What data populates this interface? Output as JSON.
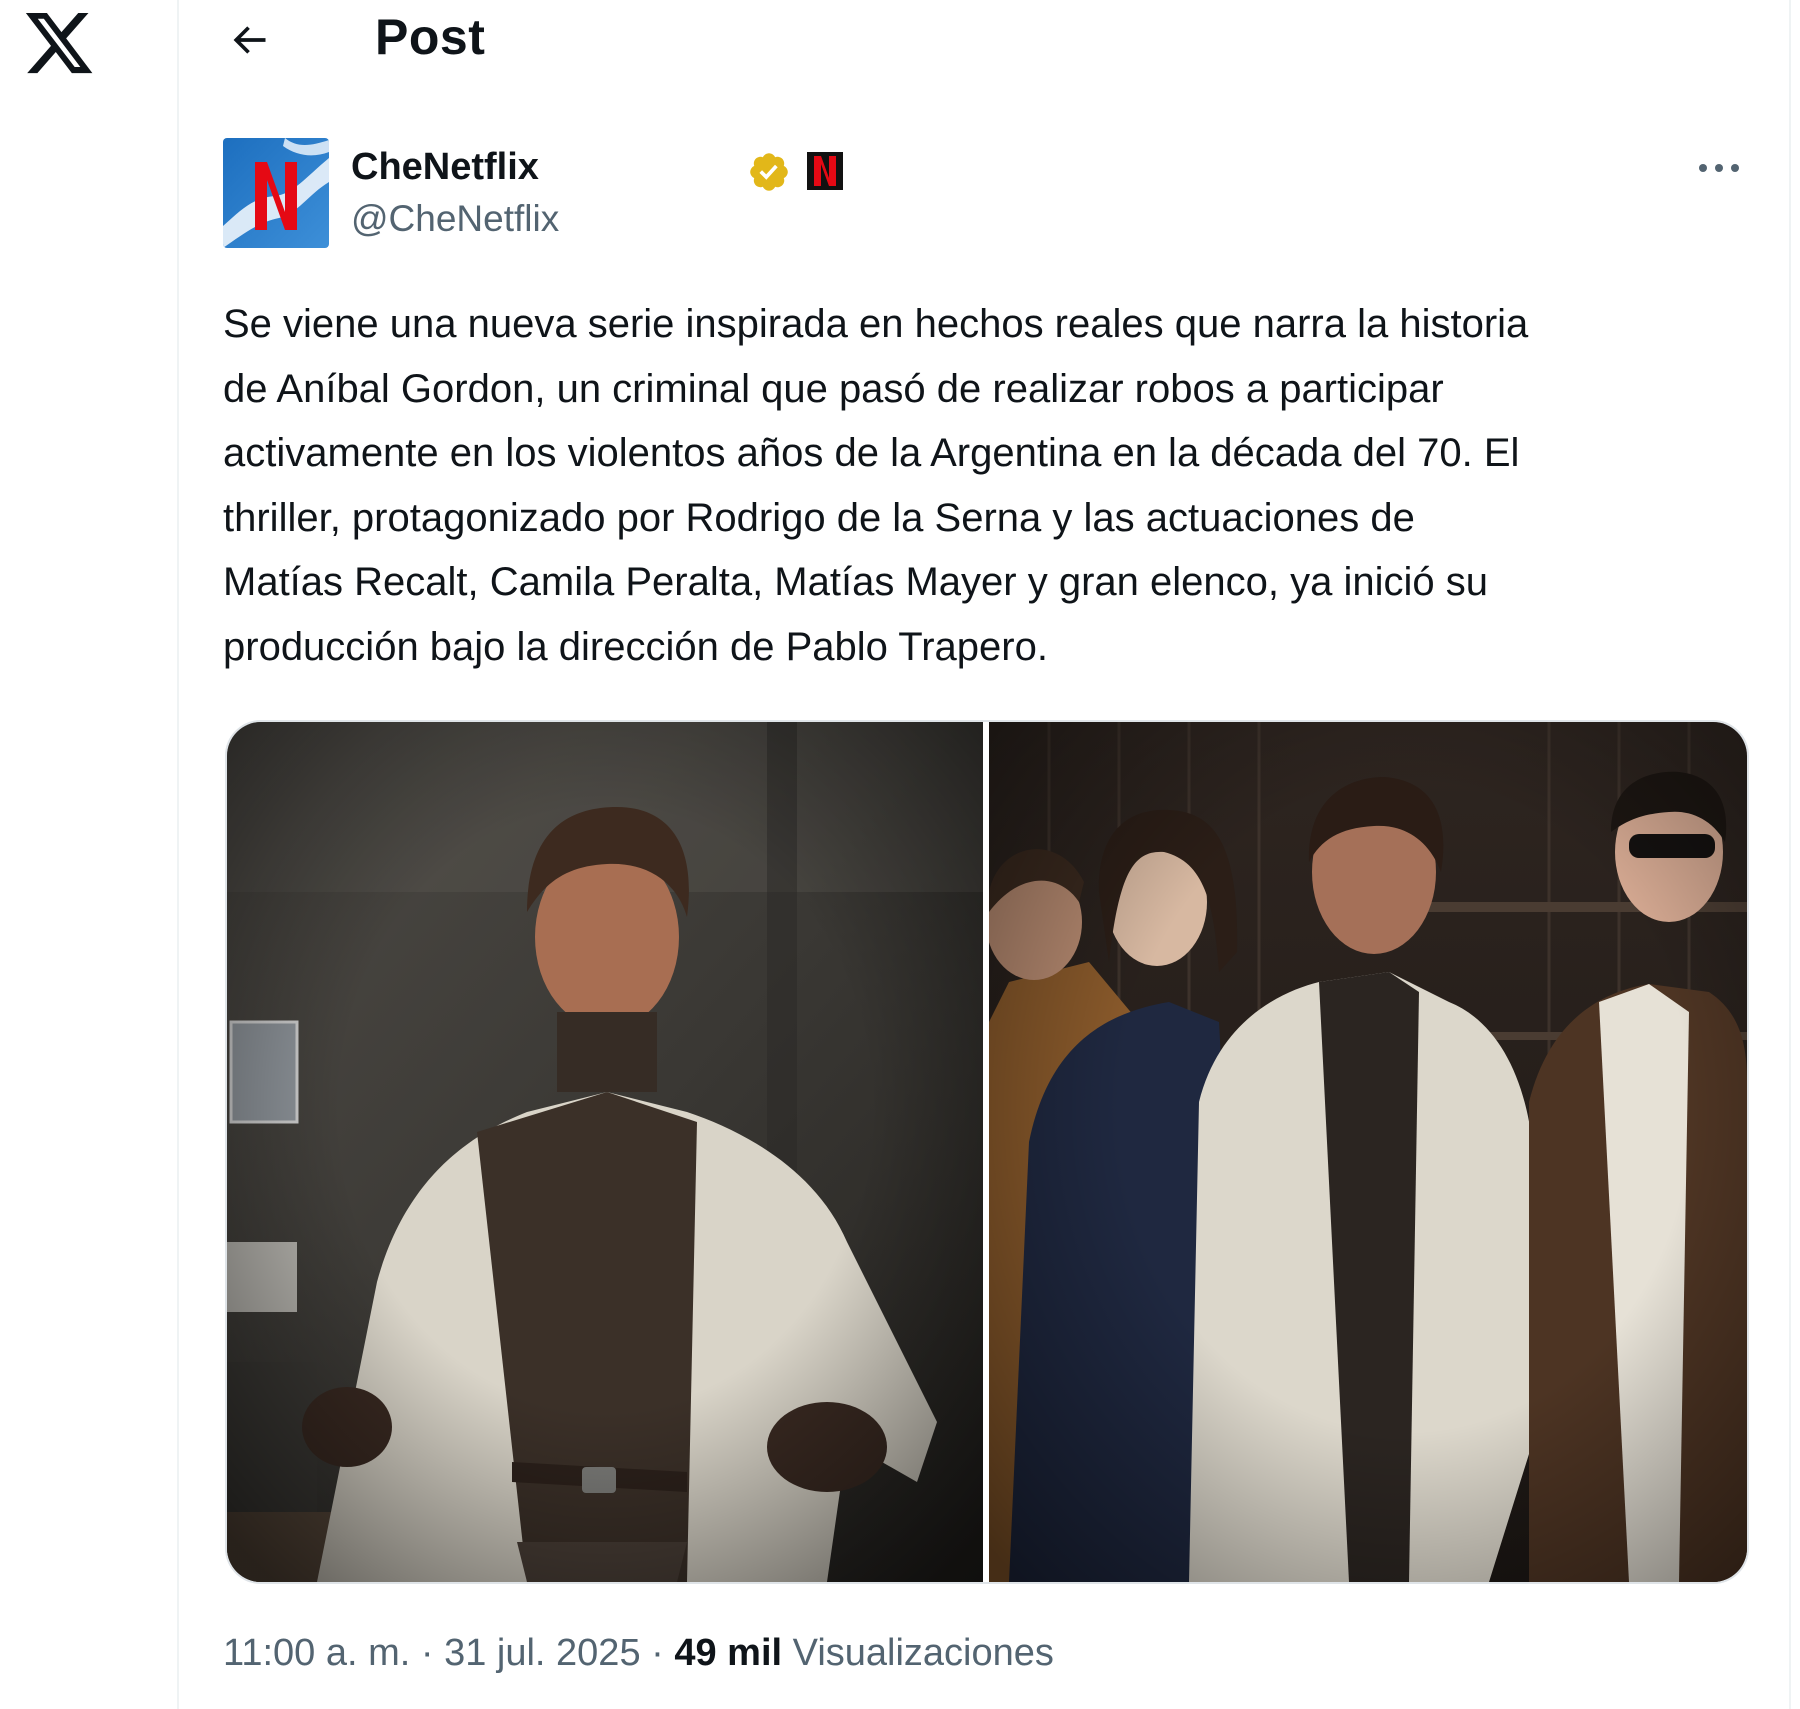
{
  "page": {
    "header_title": "Post"
  },
  "post": {
    "author": {
      "name": "CheNetflix",
      "handle": "@CheNetflix",
      "verified": true,
      "emoji_icon": "netflix-n-icon"
    },
    "text": "Se viene una nueva serie inspirada en hechos reales que narra la historia\nde Aníbal Gordon, un criminal que pasó de realizar robos a participar\nactivamente en los violentos años de la Argentina en la década del 70. El\nthriller, protagonizado por Rodrigo de la Serna y las actuaciones de\nMatías Recalt, Camila Peralta, Matías Mayer y gran elenco, ya inició su\nproducción bajo la dirección de Pablo Trapero.",
    "media_count": 2,
    "time": "11:00 a. m.",
    "date": "31 jul. 2025",
    "separator": "·",
    "views_count": "49 mil",
    "views_label": "Visualizaciones"
  },
  "colors": {
    "text": "#0f1419",
    "secondary_text": "#536471",
    "verified_badge": "#e2b719",
    "border": "#eff3f4",
    "netflix_red": "#e50914"
  },
  "icons": {
    "logo": "x-logo-icon",
    "back": "arrow-left-icon",
    "more": "more-horizontal-icon",
    "verified": "verified-badge-icon"
  }
}
